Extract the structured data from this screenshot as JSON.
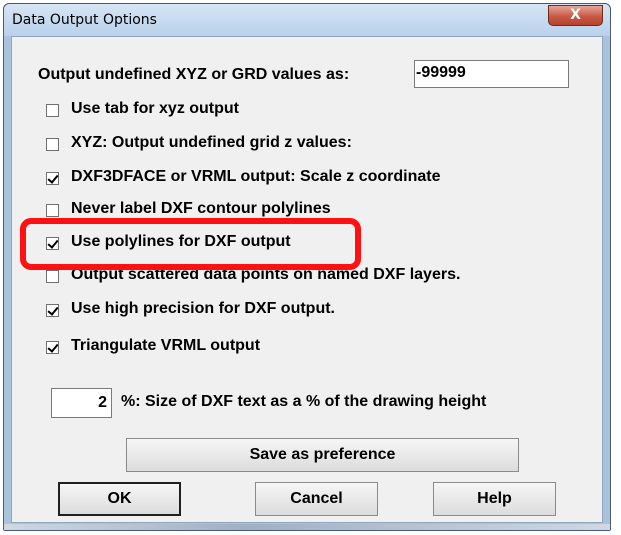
{
  "window": {
    "title": "Data Output Options",
    "close_glyph": "X"
  },
  "undefined_value": {
    "label": "Output undefined XYZ or GRD values as:",
    "value": "-99999"
  },
  "options": [
    {
      "label": "Use tab for xyz output",
      "checked": false
    },
    {
      "label": "XYZ: Output undefined grid z values:",
      "checked": false
    },
    {
      "label": "DXF3DFACE or VRML output: Scale z coordinate",
      "checked": true
    },
    {
      "label": "Never label DXF contour polylines",
      "checked": false
    },
    {
      "label": "Use polylines for DXF output",
      "checked": true
    },
    {
      "label": "Output scattered data points on named DXF layers.",
      "checked": false
    },
    {
      "label": "Use high precision for DXF output.",
      "checked": true
    },
    {
      "label": "Triangulate VRML output",
      "checked": true
    }
  ],
  "text_size": {
    "value": "2",
    "label": "%: Size of DXF text as a % of the drawing height"
  },
  "buttons": {
    "save_pref": "Save as preference",
    "ok": "OK",
    "cancel": "Cancel",
    "help": "Help"
  },
  "annotation": {
    "highlight_color": "#ff1111"
  }
}
